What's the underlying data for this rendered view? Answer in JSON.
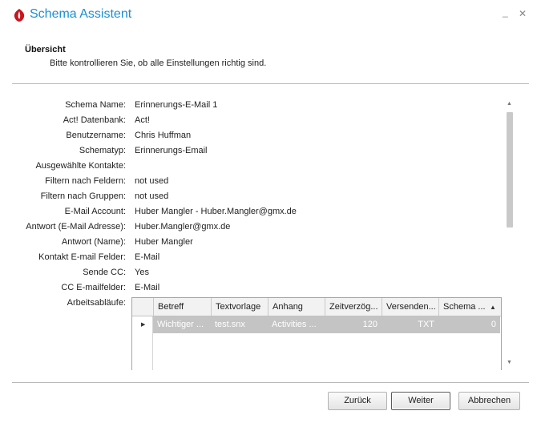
{
  "window": {
    "title": "Schema Assistent",
    "minimize_glyph": "_",
    "close_glyph": "✕",
    "logo_icon": "flame-logo-icon",
    "accent_color": "#1a8fd6"
  },
  "section": {
    "title": "Übersicht",
    "subtitle": "Bitte kontrollieren Sie, ob alle Einstellungen richtig sind."
  },
  "summary": [
    {
      "label": "Schema Name:",
      "value": "Erinnerungs-E-Mail 1"
    },
    {
      "label": "Act! Datenbank:",
      "value": "Act!"
    },
    {
      "label": "Benutzername:",
      "value": "Chris Huffman"
    },
    {
      "label": "Schematyp:",
      "value": "Erinnerungs-Email"
    },
    {
      "label": "Ausgewählte Kontakte:",
      "value": ""
    },
    {
      "label": "Filtern nach Feldern:",
      "value": "not used"
    },
    {
      "label": "Filtern nach Gruppen:",
      "value": "not used"
    },
    {
      "label": "E-Mail Account:",
      "value": "Huber Mangler - Huber.Mangler@gmx.de"
    },
    {
      "label": "Antwort (E-Mail Adresse):",
      "value": "Huber.Mangler@gmx.de"
    },
    {
      "label": "Antwort (Name):",
      "value": "Huber Mangler"
    },
    {
      "label": "Kontakt E-mail Felder:",
      "value": "E-Mail"
    },
    {
      "label": "Sende CC:",
      "value": "Yes"
    },
    {
      "label": "CC E-mailfelder:",
      "value": "E-Mail"
    },
    {
      "label": "Arbeitsabläufe:",
      "value": ""
    }
  ],
  "workflow_grid": {
    "columns": [
      "Betreff",
      "Textvorlage",
      "Anhang",
      "Zeitverzög...",
      "Versenden...",
      "Schema ..."
    ],
    "rows": [
      [
        "Wichtiger ...",
        "test.snx",
        "Activities ...",
        "120",
        "TXT",
        "0"
      ]
    ],
    "sort_glyph": "▲",
    "row_indicator_glyph": "▶"
  },
  "scrollbar": {
    "up_glyph": "▲",
    "down_glyph": "▼"
  },
  "buttons": {
    "back": "Zurück",
    "next": "Weiter",
    "cancel": "Abbrechen"
  }
}
